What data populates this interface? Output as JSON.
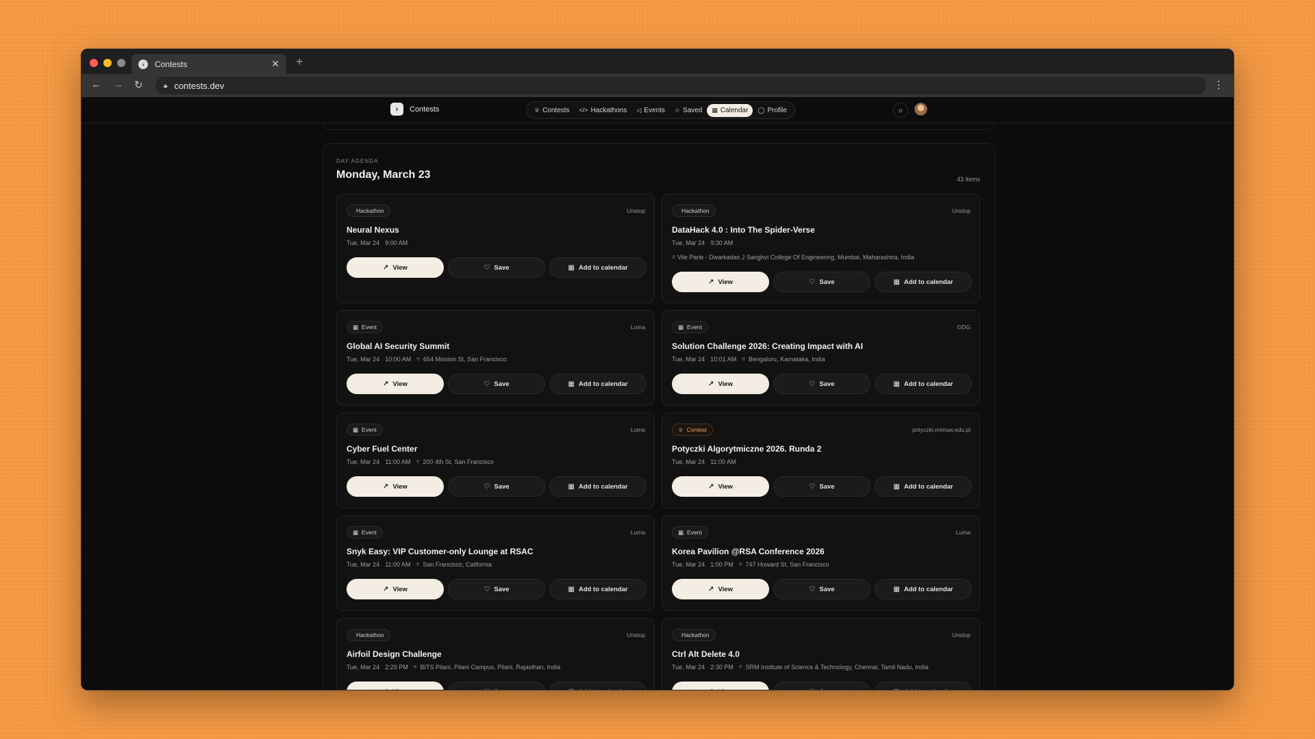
{
  "browser": {
    "tab_title": "Contests",
    "tab_favicon": "›",
    "new_tab": "+",
    "close_tab": "✕",
    "url": "contests.dev"
  },
  "site": {
    "brand": "Contests",
    "nav": [
      {
        "label": "Contests",
        "icon": "trophy-icon",
        "glyph": "♕",
        "active": false
      },
      {
        "label": "Hackathons",
        "icon": "code-icon",
        "glyph": "</>",
        "active": false
      },
      {
        "label": "Events",
        "icon": "megaphone-icon",
        "glyph": "◁",
        "active": false
      },
      {
        "label": "Saved",
        "icon": "star-icon",
        "glyph": "☆",
        "active": false
      },
      {
        "label": "Calendar",
        "icon": "calendar-icon",
        "glyph": "▦",
        "active": true
      },
      {
        "label": "Profile",
        "icon": "user-icon",
        "glyph": "◯",
        "active": false
      }
    ],
    "theme_glyph": "☼"
  },
  "agenda": {
    "kicker": "DAY AGENDA",
    "title": "Monday, March 23",
    "count": "43 items",
    "buttons": {
      "view": "View",
      "save": "Save",
      "calendar": "Add to calendar"
    },
    "items": [
      {
        "type": "Hackathon",
        "source": "Unstop",
        "title": "Neural Nexus",
        "date": "Tue, Mar 24",
        "time": "9:00 AM",
        "location": "",
        "full_location": ""
      },
      {
        "type": "Hackathon",
        "source": "Unstop",
        "title": "DataHack 4.0 : Into The Spider-Verse",
        "date": "Tue, Mar 24",
        "time": "9:30 AM",
        "location": "",
        "full_location": "Vile Parle - Dwarkadas J Sanghvi College Of Engineering, Mumbai, Maharashtra, India"
      },
      {
        "type": "Event",
        "source": "Luma",
        "title": "Global AI Security Summit",
        "date": "Tue, Mar 24",
        "time": "10:00 AM",
        "location": "654 Mission St, San Francisco",
        "full_location": ""
      },
      {
        "type": "Event",
        "source": "GDG",
        "title": "Solution Challenge 2026: Creating Impact with AI",
        "date": "Tue, Mar 24",
        "time": "10:01 AM",
        "location": "Bengaluru, Karnataka, India",
        "full_location": ""
      },
      {
        "type": "Event",
        "source": "Luma",
        "title": "Cyber Fuel Center",
        "date": "Tue, Mar 24",
        "time": "11:00 AM",
        "location": "200 4th St, San Francisco",
        "full_location": ""
      },
      {
        "type": "Contest",
        "source": "potyczki.mimuw.edu.pl",
        "title": "Potyczki Algorytmiczne 2026. Runda 2",
        "date": "Tue, Mar 24",
        "time": "11:00 AM",
        "location": "",
        "full_location": ""
      },
      {
        "type": "Event",
        "source": "Luma",
        "title": "Snyk Easy: VIP Customer-only Lounge at RSAC",
        "date": "Tue, Mar 24",
        "time": "11:00 AM",
        "location": "San Francisco, California",
        "full_location": ""
      },
      {
        "type": "Event",
        "source": "Luma",
        "title": "Korea Pavilion @RSA Conference 2026",
        "date": "Tue, Mar 24",
        "time": "1:00 PM",
        "location": "747 Howard St, San Francisco",
        "full_location": ""
      },
      {
        "type": "Hackathon",
        "source": "Unstop",
        "title": "Airfoil Design Challenge",
        "date": "Tue, Mar 24",
        "time": "2:29 PM",
        "location": "BITS Pilani, Pilani Campus, Pilani, Rajasthan, India",
        "full_location": ""
      },
      {
        "type": "Hackathon",
        "source": "Unstop",
        "title": "Ctrl Alt Delete 4.0",
        "date": "Tue, Mar 24",
        "time": "2:30 PM",
        "location": "SRM Institute of Science & Technology, Chennai, Tamil Nadu, India",
        "full_location": ""
      }
    ]
  }
}
